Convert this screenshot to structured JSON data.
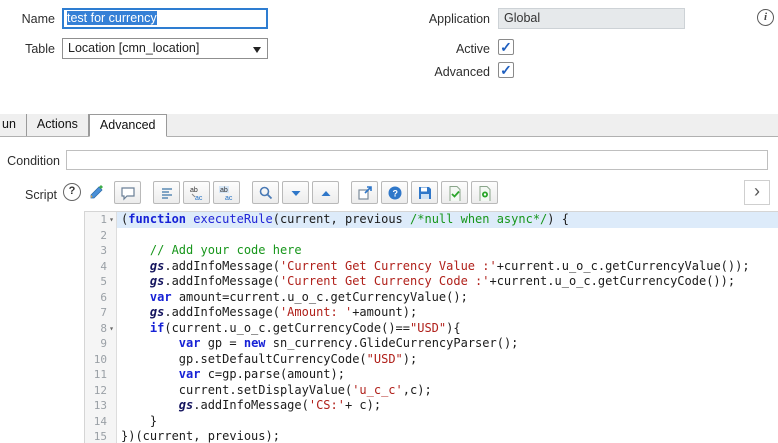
{
  "colors": {
    "accent": "#2e7dd1",
    "selection": "#3580d6",
    "keyword": "#1621d6",
    "string": "#b0201a",
    "comment": "#17961b",
    "active_line": "#ddebfa"
  },
  "form": {
    "name": {
      "label": "Name",
      "value": "test for currency"
    },
    "table": {
      "label": "Table",
      "value": "Location [cmn_location]"
    },
    "application": {
      "label": "Application",
      "value": "Global"
    },
    "active": {
      "label": "Active",
      "checked": true
    },
    "advanced": {
      "label": "Advanced",
      "checked": true
    }
  },
  "tabs": [
    {
      "label": "un",
      "active": false
    },
    {
      "label": "Actions",
      "active": false
    },
    {
      "label": "Advanced",
      "active": true
    }
  ],
  "condition": {
    "label": "Condition",
    "value": ""
  },
  "script": {
    "label": "Script",
    "toolbar": [
      {
        "name": "toggle-comment-button",
        "icon": "comment"
      },
      {
        "name": "format-code-button",
        "icon": "format",
        "group_start": true
      },
      {
        "name": "replace-button",
        "icon": "replace"
      },
      {
        "name": "replace-all-button",
        "icon": "replace-all"
      },
      {
        "name": "search-button",
        "icon": "search",
        "group_start": true
      },
      {
        "name": "find-next-button",
        "icon": "chevron-down"
      },
      {
        "name": "find-previous-button",
        "icon": "chevron-up"
      },
      {
        "name": "open-in-window-button",
        "icon": "popout",
        "group_start": true
      },
      {
        "name": "editor-help-button",
        "icon": "question"
      },
      {
        "name": "save-button",
        "icon": "save"
      },
      {
        "name": "syntax-check-button",
        "icon": "doc-check"
      },
      {
        "name": "create-macro-button",
        "icon": "doc-gear"
      }
    ]
  },
  "editor": {
    "lines": [
      {
        "n": 1,
        "fold": true,
        "active": true,
        "tokens": [
          [
            "p",
            "("
          ],
          [
            "k",
            "function"
          ],
          [
            "d",
            " executeRule"
          ],
          [
            "p",
            "(current, previous "
          ],
          [
            "c",
            "/*null when async*/"
          ],
          [
            "p",
            ") {"
          ]
        ]
      },
      {
        "n": 2,
        "tokens": []
      },
      {
        "n": 3,
        "tokens": [
          [
            "c",
            "    // Add your code here"
          ]
        ]
      },
      {
        "n": 4,
        "tokens": [
          [
            "p",
            "    "
          ],
          [
            "g",
            "gs"
          ],
          [
            "p",
            ".addInfoMessage("
          ],
          [
            "s",
            "'Current Get Currency Value :'"
          ],
          [
            "p",
            "+current.u_o_c.getCurrencyValue());"
          ]
        ]
      },
      {
        "n": 5,
        "tokens": [
          [
            "p",
            "    "
          ],
          [
            "g",
            "gs"
          ],
          [
            "p",
            ".addInfoMessage("
          ],
          [
            "s",
            "'Current Get Currency Code :'"
          ],
          [
            "p",
            "+current.u_o_c.getCurrencyCode());"
          ]
        ]
      },
      {
        "n": 6,
        "tokens": [
          [
            "p",
            "    "
          ],
          [
            "k",
            "var"
          ],
          [
            "p",
            " amount=current.u_o_c.getCurrencyValue();"
          ]
        ]
      },
      {
        "n": 7,
        "tokens": [
          [
            "p",
            "    "
          ],
          [
            "g",
            "gs"
          ],
          [
            "p",
            ".addInfoMessage("
          ],
          [
            "s",
            "'Amount: '"
          ],
          [
            "p",
            "+amount);"
          ]
        ]
      },
      {
        "n": 8,
        "fold": true,
        "tokens": [
          [
            "p",
            "    "
          ],
          [
            "k",
            "if"
          ],
          [
            "p",
            "(current.u_o_c.getCurrencyCode()=="
          ],
          [
            "s",
            "\"USD\""
          ],
          [
            "p",
            "){"
          ]
        ]
      },
      {
        "n": 9,
        "tokens": [
          [
            "p",
            "        "
          ],
          [
            "k",
            "var"
          ],
          [
            "p",
            " gp = "
          ],
          [
            "k",
            "new"
          ],
          [
            "p",
            " sn_currency.GlideCurrencyParser();"
          ]
        ]
      },
      {
        "n": 10,
        "tokens": [
          [
            "p",
            "        gp.setDefaultCurrencyCode("
          ],
          [
            "s",
            "\"USD\""
          ],
          [
            "p",
            ");"
          ]
        ]
      },
      {
        "n": 11,
        "tokens": [
          [
            "p",
            "        "
          ],
          [
            "k",
            "var"
          ],
          [
            "p",
            " c=gp.parse(amount);"
          ]
        ]
      },
      {
        "n": 12,
        "tokens": [
          [
            "p",
            "        current.setDisplayValue("
          ],
          [
            "s",
            "'u_c_c'"
          ],
          [
            "p",
            ",c);"
          ]
        ]
      },
      {
        "n": 13,
        "tokens": [
          [
            "p",
            "        "
          ],
          [
            "g",
            "gs"
          ],
          [
            "p",
            ".addInfoMessage("
          ],
          [
            "s",
            "'CS:'"
          ],
          [
            "p",
            "+ c);"
          ]
        ]
      },
      {
        "n": 14,
        "tokens": [
          [
            "p",
            "    }"
          ]
        ]
      },
      {
        "n": 15,
        "tokens": [
          [
            "p",
            "})(current, previous);"
          ]
        ]
      }
    ]
  }
}
